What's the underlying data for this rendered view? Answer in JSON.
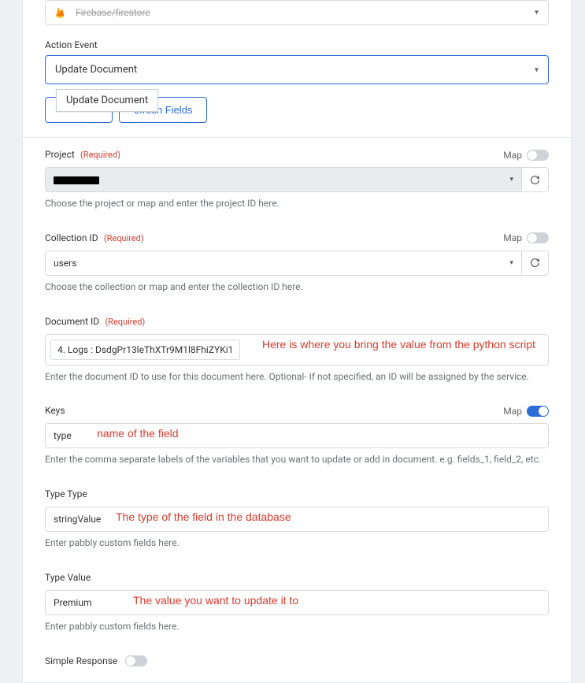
{
  "app": {
    "name": "Firebase/firestore"
  },
  "action": {
    "label": "Action Event",
    "selected": "Update Document",
    "tooltip": "Update Document",
    "refresh_btn": "efresh Fields"
  },
  "map_label": "Map",
  "project": {
    "label": "Project",
    "required": "(Required)",
    "help": "Choose the project or map and enter the project ID here."
  },
  "collection": {
    "label": "Collection ID",
    "required": "(Required)",
    "value": "users",
    "help": "Choose the collection or map and enter the collection ID here."
  },
  "document": {
    "label": "Document ID",
    "required": "(Required)",
    "value": "4. Logs : DsdgPr13leThXTr9M1l8FhiZYKi1",
    "help": "Enter the document ID to use for this document here. Optional- If not specified, an ID will be assigned by the service.",
    "anno": "Here is where you bring the value from the python script"
  },
  "keys": {
    "label": "Keys",
    "value": "type",
    "help": "Enter the comma separate labels of the variables that you want to update or add in document. e.g. fields_1, field_2, etc.",
    "anno": "name of the field"
  },
  "type_type": {
    "label": "Type Type",
    "value": "stringValue",
    "help": "Enter pabbly custom fields here.",
    "anno": "The type of the field in the database"
  },
  "type_value": {
    "label": "Type Value",
    "value": "Premium",
    "help": "Enter pabbly custom fields here.",
    "anno": "The value you want to update it to"
  },
  "simple": {
    "label": "Simple Response"
  }
}
